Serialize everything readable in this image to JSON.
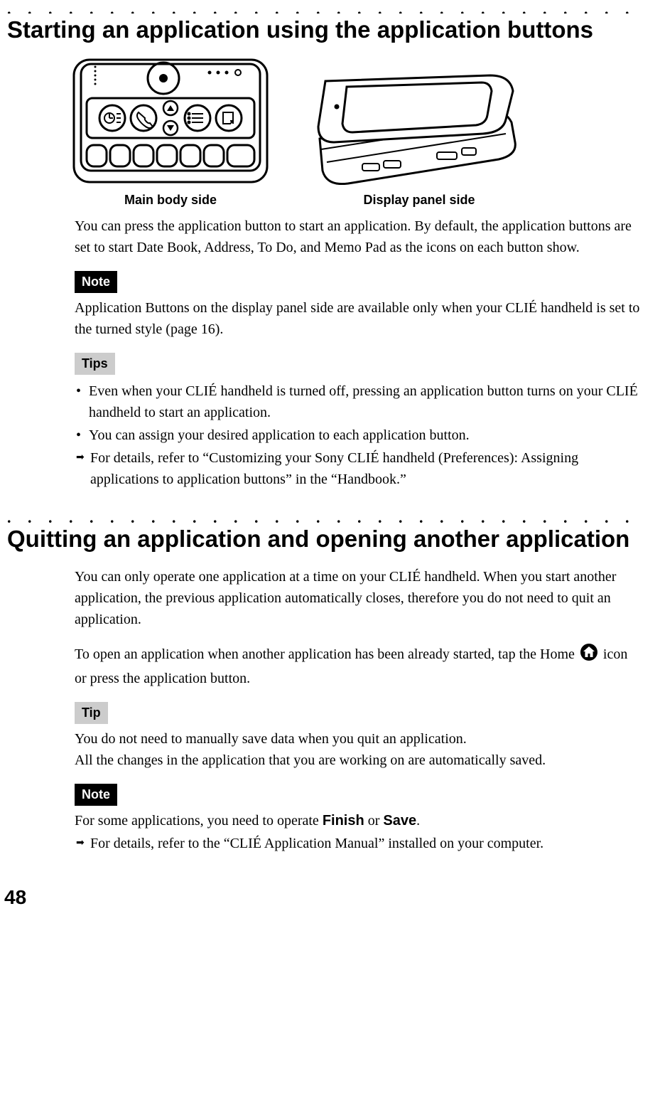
{
  "section1": {
    "title": "Starting an application using the application buttons",
    "fig1_caption": "Main body side",
    "fig2_caption": "Display panel side",
    "intro": "You can press the application button to start an application. By default, the application buttons are set to start Date Book, Address, To Do, and Memo Pad as the icons on each button show.",
    "note_label": "Note",
    "note_text": "Application Buttons on the display panel side are available only when your CLIÉ handheld is set to the turned style (page 16).",
    "tips_label": "Tips",
    "tip_items": [
      "Even when your CLIÉ handheld is turned off, pressing an application button turns on your CLIÉ handheld to start an application.",
      "You can assign your desired application to each application button."
    ],
    "tips_arrow": "For details, refer to “Customizing your Sony CLIÉ handheld (Preferences): Assigning applications to application buttons” in the “Handbook.”"
  },
  "section2": {
    "title": "Quitting an application and opening another application",
    "para1": "You can only operate one application at a time on your CLIÉ handheld. When you start another application, the previous application automatically closes, therefore you do not need to quit an application.",
    "para2a": "To open an application when another application has been already started, tap the Home ",
    "para2b": " icon or press the application button.",
    "tip_label": "Tip",
    "tip_text_line1": "You do not need to manually save data when you quit an application.",
    "tip_text_line2": "All the changes in the application that you are working on are automatically saved.",
    "note_label": "Note",
    "note_text_a": "For some applications, you need to operate ",
    "note_text_finish": "Finish",
    "note_text_or": " or ",
    "note_text_save": "Save",
    "note_text_b": ".",
    "note_arrow": "For details, refer to the “CLIÉ Application Manual” installed on your computer."
  },
  "page_number": "48"
}
